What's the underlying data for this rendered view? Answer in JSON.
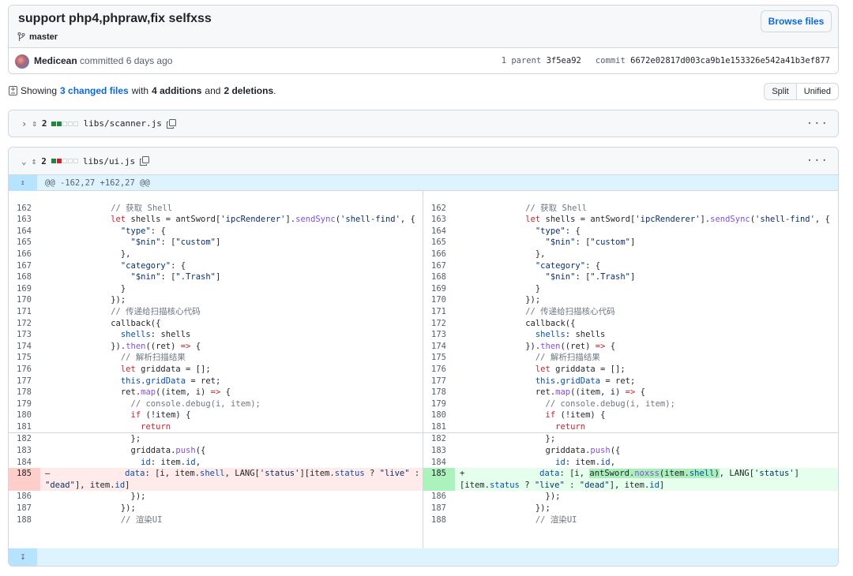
{
  "commit": {
    "title": "support php4,phpraw,fix selfxss",
    "branch": "master",
    "browse_label": "Browse files",
    "author": "Medicean",
    "committed_text": "committed 6 days ago",
    "parent_label": "1 parent",
    "parent_sha": "3f5ea92",
    "commit_label": "commit",
    "commit_sha": "6672e02817d003ca9b1e153326e542a41b3ef877"
  },
  "summary": {
    "showing": "Showing",
    "changed_files": "3 changed files",
    "with": "with",
    "additions": "4 additions",
    "and": "and",
    "deletions": "2 deletions",
    "period": "."
  },
  "view_toggle": {
    "split": "Split",
    "unified": "Unified",
    "selected": "Split"
  },
  "files": [
    {
      "name": "libs/scanner.js",
      "count": "2",
      "expanded": false
    },
    {
      "name": "libs/ui.js",
      "count": "2",
      "expanded": true
    }
  ],
  "hunk_header": "@@ -162,27 +162,27 @@",
  "icons": {
    "branch": "git-branch-icon",
    "copy": "copy-icon",
    "kebab": "kebab-icon",
    "expand": "expand-up-icon"
  },
  "colors": {
    "link": "#0969da",
    "add": "#1f883d",
    "del": "#cf222e",
    "hunk": "#ddf4ff"
  }
}
